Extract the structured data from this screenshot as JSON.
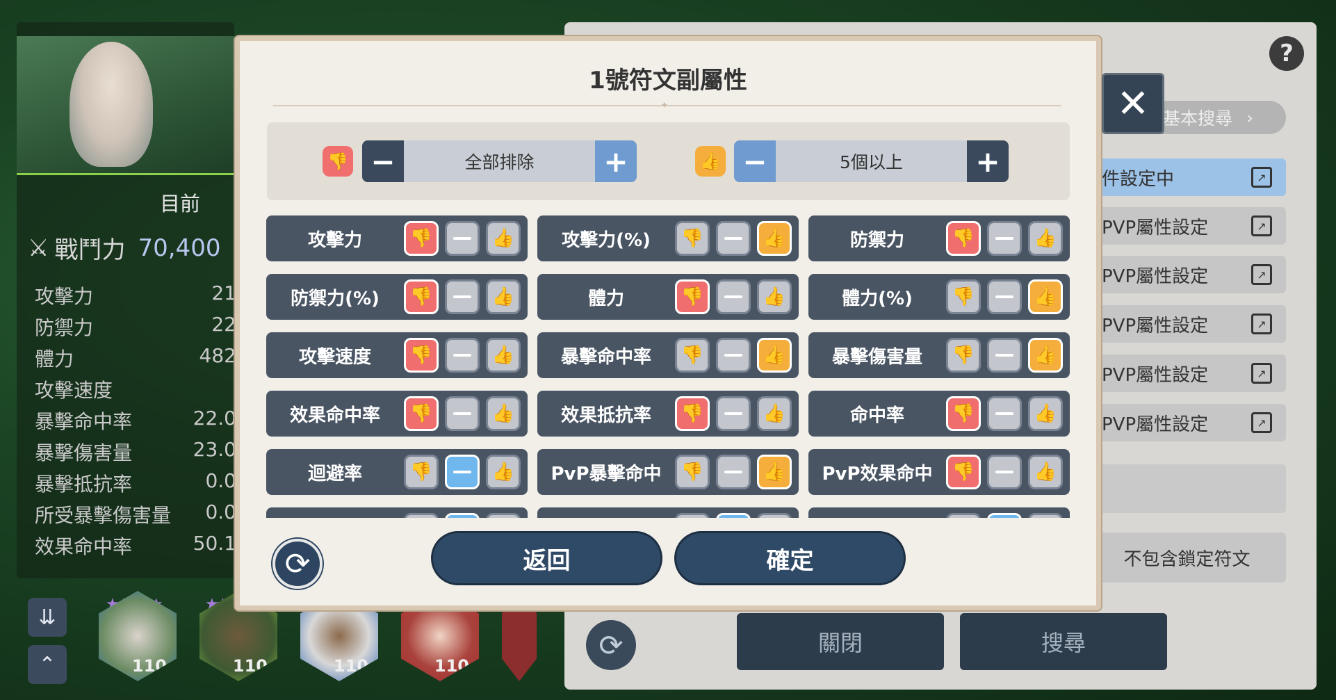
{
  "left": {
    "current_label": "目前",
    "power_label": "戰鬥力",
    "power_value": "70,400",
    "stats": [
      {
        "name": "攻擊力",
        "value": "21"
      },
      {
        "name": "防禦力",
        "value": "22"
      },
      {
        "name": "體力",
        "value": "482"
      },
      {
        "name": "攻擊速度",
        "value": ""
      },
      {
        "name": "暴擊命中率",
        "value": "22.0"
      },
      {
        "name": "暴擊傷害量",
        "value": "23.0"
      },
      {
        "name": "暴擊抵抗率",
        "value": "0.0"
      },
      {
        "name": "所受暴擊傷害量",
        "value": "0.0"
      },
      {
        "name": "效果命中率",
        "value": "50.1"
      }
    ],
    "heroes": [
      {
        "level": "110",
        "stars": "★★★★★"
      },
      {
        "level": "110",
        "stars": "★★★"
      },
      {
        "level": "110",
        "stars": ""
      },
      {
        "level": "110",
        "stars": ""
      }
    ]
  },
  "right": {
    "help": "?",
    "basic_search": "基本搜尋",
    "rows": [
      "件設定中",
      "PVP屬性設定",
      "PVP屬性設定",
      "PVP屬性設定",
      "PVP屬性設定",
      "PVP屬性設定"
    ],
    "no_lock": "不包含鎖定符文",
    "close_btn": "關閉",
    "search_btn": "搜尋"
  },
  "modal": {
    "title": "1號符文副屬性",
    "dislike_filter": "全部排除",
    "like_filter": "5個以上",
    "back": "返回",
    "confirm": "確定",
    "attributes": [
      {
        "name": "攻擊力",
        "selected": "dislike"
      },
      {
        "name": "攻擊力(%)",
        "selected": "like"
      },
      {
        "name": "防禦力",
        "selected": "dislike"
      },
      {
        "name": "防禦力(%)",
        "selected": "dislike"
      },
      {
        "name": "體力",
        "selected": "dislike"
      },
      {
        "name": "體力(%)",
        "selected": "like"
      },
      {
        "name": "攻擊速度",
        "selected": "dislike"
      },
      {
        "name": "暴擊命中率",
        "selected": "like"
      },
      {
        "name": "暴擊傷害量",
        "selected": "like"
      },
      {
        "name": "效果命中率",
        "selected": "dislike"
      },
      {
        "name": "效果抵抗率",
        "selected": "dislike"
      },
      {
        "name": "命中率",
        "selected": "dislike"
      },
      {
        "name": "迴避率",
        "selected": "neutral"
      },
      {
        "name": "PvP暴擊命中",
        "selected": "like"
      },
      {
        "name": "PvP效果命中",
        "selected": "dislike"
      }
    ]
  },
  "colors": {
    "dislike": "#f06e6e",
    "like": "#f5ae3c",
    "neutral_selected": "#70b7ee",
    "cell_bg": "#4a5564"
  }
}
